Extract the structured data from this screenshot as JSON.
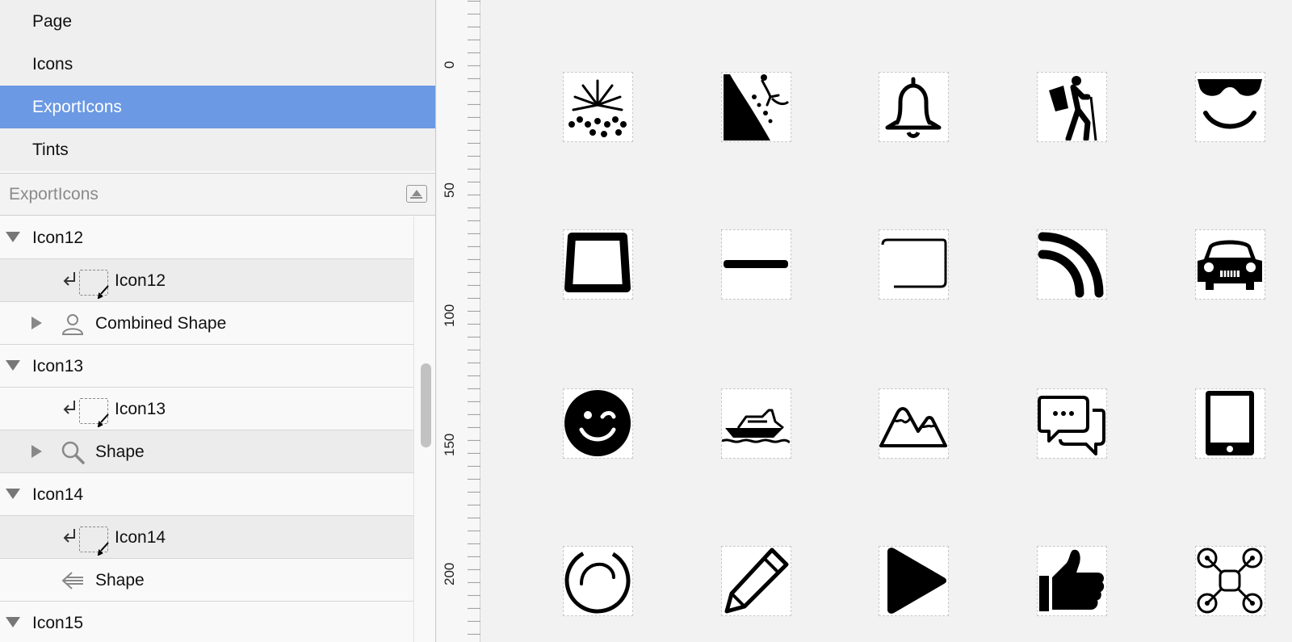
{
  "pages": [
    {
      "label": "Page",
      "selected": false
    },
    {
      "label": "Icons",
      "selected": false
    },
    {
      "label": "ExportIcons",
      "selected": true
    },
    {
      "label": "Tints",
      "selected": false
    }
  ],
  "layers_header": {
    "title": "ExportIcons"
  },
  "layers": {
    "icon12": {
      "label": "Icon12",
      "mask_label": "Icon12",
      "child_label": "Combined Shape",
      "child_icon": "person-icon"
    },
    "icon13": {
      "label": "Icon13",
      "mask_label": "Icon13",
      "child_label": "Shape",
      "child_icon": "magnifier-icon"
    },
    "icon14": {
      "label": "Icon14",
      "mask_label": "Icon14",
      "child_label": "Shape",
      "child_icon": "arrow-left-icon"
    },
    "icon15": {
      "label": "Icon15"
    }
  },
  "ruler": {
    "labels": [
      "0",
      "50",
      "100",
      "150",
      "200"
    ]
  },
  "canvas": {
    "icons": [
      "fireworks-icon",
      "landslide-icon",
      "bell-icon",
      "hiker-icon",
      "cool-face-icon",
      "trapezoid-icon",
      "minus-icon",
      "rounded-rect-icon",
      "wifi-signal-icon",
      "car-front-icon",
      "wink-face-icon",
      "yacht-icon",
      "mountains-icon",
      "chat-bubbles-icon",
      "smartphone-icon",
      "refresh-circle-icon",
      "pencil-icon",
      "play-icon",
      "thumbs-up-icon",
      "drone-icon"
    ]
  },
  "colors": {
    "selection": "#6b99e3",
    "panel": "#f9f9f9",
    "canvas": "#f2f2f2"
  }
}
